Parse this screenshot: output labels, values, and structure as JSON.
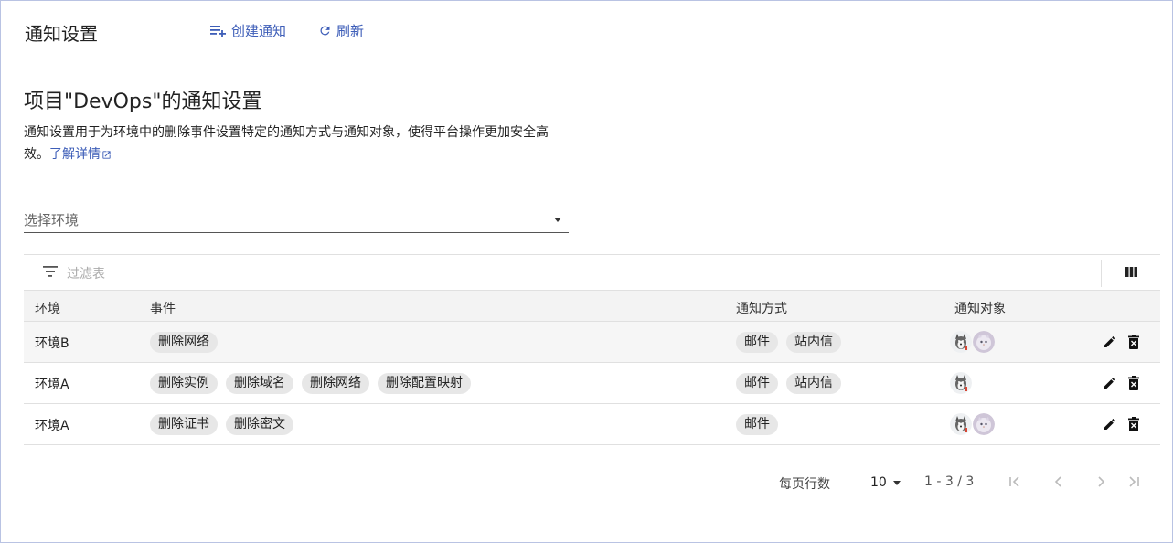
{
  "header": {
    "title": "通知设置",
    "create_label": "创建通知",
    "refresh_label": "刷新"
  },
  "main": {
    "title": "项目\"DevOps\"的通知设置",
    "description": "通知设置用于为环境中的删除事件设置特定的通知方式与通知对象，使得平台操作更加安全高效。",
    "learn_more": "了解详情",
    "env_select": {
      "label": "选择环境"
    },
    "filter": {
      "placeholder": "过滤表"
    }
  },
  "table": {
    "columns": [
      "环境",
      "事件",
      "通知方式",
      "通知对象"
    ],
    "rows": [
      {
        "env": "环境B",
        "events": [
          "删除网络"
        ],
        "methods": [
          "邮件",
          "站内信"
        ],
        "recipients": [
          "husky-avatar",
          "cat-avatar"
        ]
      },
      {
        "env": "环境A",
        "events": [
          "删除实例",
          "删除域名",
          "删除网络",
          "删除配置映射"
        ],
        "methods": [
          "邮件",
          "站内信"
        ],
        "recipients": [
          "husky-avatar"
        ]
      },
      {
        "env": "环境A",
        "events": [
          "删除证书",
          "删除密文"
        ],
        "methods": [
          "邮件"
        ],
        "recipients": [
          "husky-avatar",
          "cat-avatar"
        ]
      }
    ]
  },
  "pagination": {
    "rows_per_page_label": "每页行数",
    "rows_per_page": "10",
    "range": "1 - 3 / 3"
  },
  "colors": {
    "accent": "#3e5eb8",
    "chip_bg": "#e7e7e7",
    "border": "#e0e0e0"
  },
  "icons": {
    "create": "playlist-add-icon",
    "refresh": "refresh-icon",
    "external": "external-link-icon",
    "filter": "filter-icon",
    "columns": "columns-icon",
    "edit": "edit-icon",
    "delete": "delete-icon"
  }
}
